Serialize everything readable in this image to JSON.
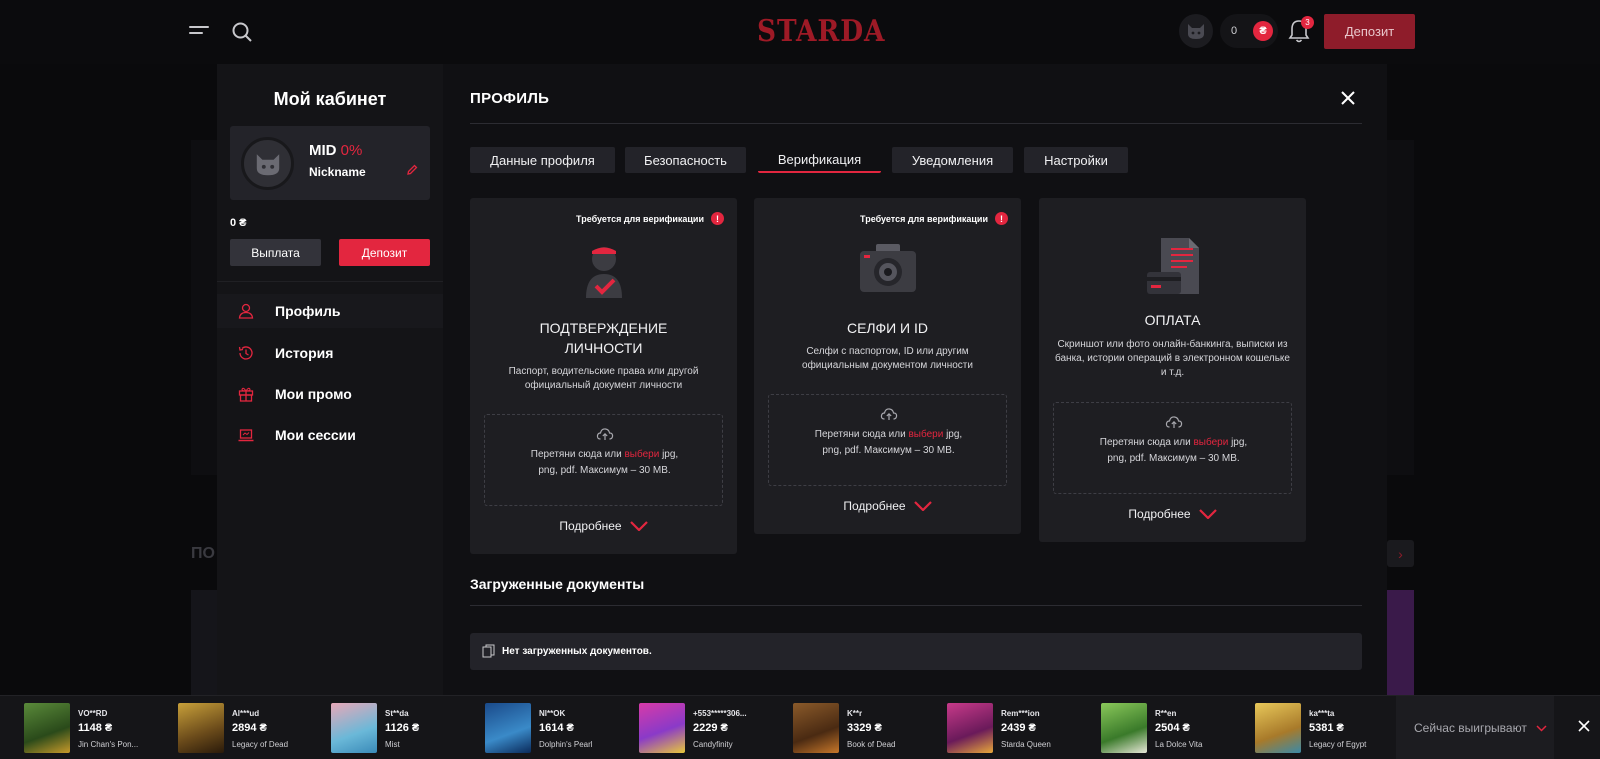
{
  "header": {
    "logo": "STARDA",
    "balance": "0",
    "currency_symbol": "₴",
    "notifications_count": "3",
    "deposit_label": "Депозит"
  },
  "background": {
    "section_heading_partial": "ПО"
  },
  "sidebar": {
    "title": "Мой кабинет",
    "level_prefix": "MID",
    "level_percent": "0%",
    "nickname": "Nickname",
    "balance": "0 ₴",
    "withdraw_label": "Выплата",
    "deposit_label": "Депозит",
    "menu": [
      {
        "label": "Профиль",
        "icon": "user-icon"
      },
      {
        "label": "История",
        "icon": "history-icon"
      },
      {
        "label": "Мои промо",
        "icon": "gift-icon"
      },
      {
        "label": "Мои сессии",
        "icon": "laptop-icon"
      }
    ]
  },
  "main": {
    "title": "ПРОФИЛЬ",
    "tabs": [
      {
        "label": "Данные профиля",
        "active": false
      },
      {
        "label": "Безопасность",
        "active": false
      },
      {
        "label": "Верификация",
        "active": true
      },
      {
        "label": "Уведомления",
        "active": false
      },
      {
        "label": "Настройки",
        "active": false
      }
    ],
    "cards": [
      {
        "required_label": "Требуется для верификации",
        "title_line1": "ПОДТВЕРЖДЕНИЕ",
        "title_line2": "ЛИЧНОСТИ",
        "description": "Паспорт, водительские права или другой официальный документ личности",
        "drop_text": "Перетяни сюда или",
        "drop_pick": "выбери",
        "drop_formats": "jpg, png, pdf. Максимум – 30 MB.",
        "more_label": "Подробнее",
        "icon": "user-check-icon"
      },
      {
        "required_label": "Требуется для верификации",
        "title_line1": "СЕЛФИ И ID",
        "title_line2": "",
        "description": "Селфи с паспортом, ID или другим официальным документом личности",
        "drop_text": "Перетяни сюда или",
        "drop_pick": "выбери",
        "drop_formats": "jpg, png, pdf. Максимум – 30 MB.",
        "more_label": "Подробнее",
        "icon": "camera-icon"
      },
      {
        "required_label": "",
        "title_line1": "ОПЛАТА",
        "title_line2": "",
        "description": "Скриншот или фото онлайн-банкинга, выписки из банка, истории операций в электронном кошельке и т.д.",
        "drop_text": "Перетяни сюда или",
        "drop_pick": "выбери",
        "drop_formats": "jpg, png, pdf. Максимум – 30 MB.",
        "more_label": "Подробнее",
        "icon": "payment-document-icon"
      }
    ],
    "docs_title": "Загруженные документы",
    "docs_empty": "Нет загруженных документов."
  },
  "ticker": {
    "items": [
      {
        "user": "VO**RD",
        "amount": "1148 ₴",
        "game": "Jin Chan's Pon...",
        "color": "#3f6b2a"
      },
      {
        "user": "Al***ud",
        "amount": "2894 ₴",
        "game": "Legacy of Dead",
        "color": "#8a6a1c"
      },
      {
        "user": "St**da",
        "amount": "1126 ₴",
        "game": "Mist",
        "color": "#6aa3c8"
      },
      {
        "user": "Nl**OK",
        "amount": "1614 ₴",
        "game": "Dolphin's Pearl",
        "color": "#1f5d8f"
      },
      {
        "user": "+553*****306...",
        "amount": "2229 ₴",
        "game": "Candyfinity",
        "color": "#b3358f"
      },
      {
        "user": "K**r",
        "amount": "3329 ₴",
        "game": "Book of Dead",
        "color": "#6b3a1c"
      },
      {
        "user": "Rem***ion",
        "amount": "2439 ₴",
        "game": "Starda Queen",
        "color": "#8a1e6e"
      },
      {
        "user": "R**en",
        "amount": "2504 ₴",
        "game": "La Dolce Vita",
        "color": "#4f8a3a"
      },
      {
        "user": "ka***ta",
        "amount": "5381 ₴",
        "game": "Legacy of Egypt",
        "color": "#a88a2a"
      }
    ],
    "winning_label": "Сейчас выигрывают"
  },
  "colors": {
    "accent": "#e3263f",
    "header_deposit": "#8e1c2a",
    "panel": "#101013",
    "card": "#1e1e22"
  }
}
